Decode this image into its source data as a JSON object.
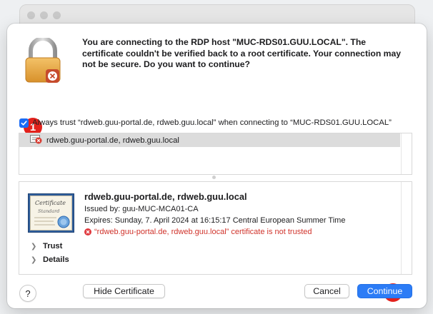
{
  "background_window": {
    "traffic_lights": [
      "close",
      "minimize",
      "zoom"
    ]
  },
  "dialog": {
    "icon": "lock-remote-desktop-icon",
    "message": "You are connecting to the RDP host \"MUC-RDS01.GUU.LOCAL\". The certificate couldn't be verified back to a root certificate. Your connection may not be secure. Do you want to continue?",
    "annotation_1": "1",
    "annotation_2": "2",
    "always_trust": {
      "checked": true,
      "label": "Always trust “rdweb.guu-portal.de, rdweb.guu.local” when connecting to “MUC-RDS01.GUU.LOCAL”"
    },
    "certificate_list": {
      "items": [
        {
          "label": "rdweb.guu-portal.de, rdweb.guu.local",
          "icon": "certificate-error-icon",
          "selected": true
        }
      ]
    },
    "certificate_detail": {
      "title": "rdweb.guu-portal.de, rdweb.guu.local",
      "issued_by": "Issued by: guu-MUC-MCA01-CA",
      "expires": "Expires: Sunday, 7. April 2024 at 16:15:17 Central European Summer Time",
      "warning": "“rdweb.guu-portal.de, rdweb.guu.local” certificate is not trusted",
      "sections": [
        "Trust",
        "Details"
      ]
    },
    "buttons": {
      "help": "?",
      "hide_certificate": "Hide Certificate",
      "cancel": "Cancel",
      "continue": "Continue"
    }
  },
  "colors": {
    "accent": "#2c7cf6",
    "annotation_red": "#e3211c",
    "warning_red": "#d0332b"
  }
}
